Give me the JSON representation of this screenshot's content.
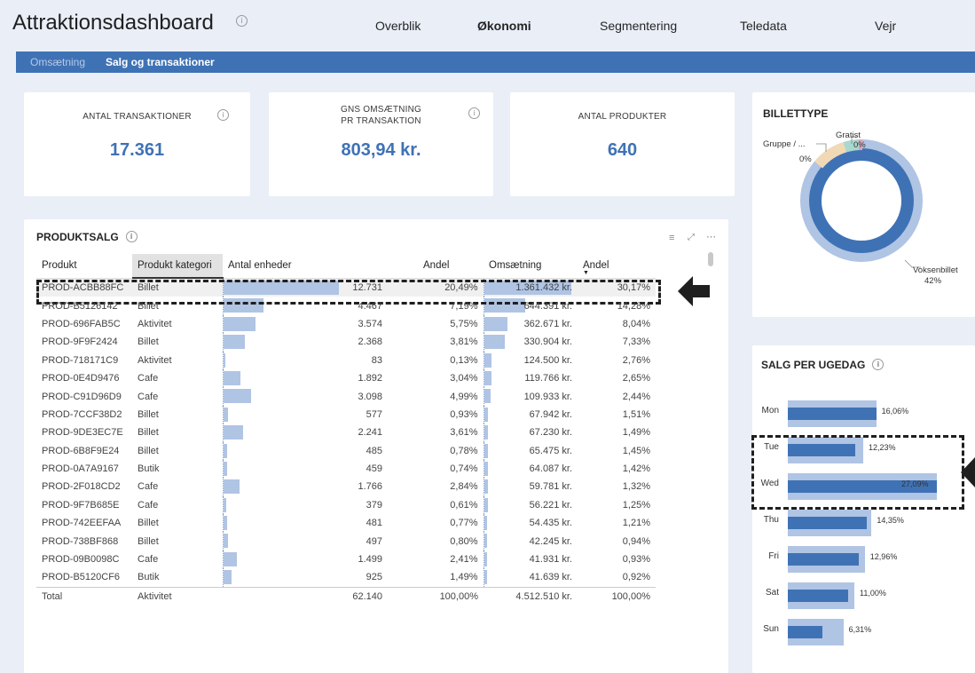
{
  "header": {
    "title": "Attraktionsdashboard",
    "nav": [
      "Overblik",
      "Økonomi",
      "Segmentering",
      "Teledata",
      "Vejr"
    ],
    "active_nav": "Økonomi"
  },
  "subnav": {
    "items": [
      "Omsætning",
      "Salg og transaktioner"
    ],
    "active": "Salg og transaktioner"
  },
  "kpis": [
    {
      "label": "ANTAL TRANSAKTIONER",
      "value": "17.361"
    },
    {
      "label": "GNS OMSÆTNING PR TRANSAKTION",
      "label_line1": "GNS OMSÆTNING",
      "label_line2": "PR TRANSAKTION",
      "value": "803,94 kr."
    },
    {
      "label": "ANTAL PRODUKTER",
      "value": "640"
    }
  ],
  "produktsalg": {
    "title": "PRODUKTSALG",
    "columns": [
      "Produkt",
      "Produkt kategori",
      "Antal enheder",
      "Andel",
      "Omsætning",
      "Andel"
    ],
    "rows": [
      {
        "produkt": "PROD-ACBB88FC",
        "kategori": "Billet",
        "enheder": "12.731",
        "enheder_frac": 1.0,
        "andel1": "20,49%",
        "omsaetning": "1.361.432 kr.",
        "oms_frac": 1.0,
        "andel2": "30,17%"
      },
      {
        "produkt": "PROD-B5126142",
        "kategori": "Billet",
        "enheder": "4.467",
        "enheder_frac": 0.351,
        "andel1": "7,19%",
        "omsaetning": "644.391 kr.",
        "oms_frac": 0.473,
        "andel2": "14,28%"
      },
      {
        "produkt": "PROD-696FAB5C",
        "kategori": "Aktivitet",
        "enheder": "3.574",
        "enheder_frac": 0.281,
        "andel1": "5,75%",
        "omsaetning": "362.671 kr.",
        "oms_frac": 0.266,
        "andel2": "8,04%"
      },
      {
        "produkt": "PROD-9F9F2424",
        "kategori": "Billet",
        "enheder": "2.368",
        "enheder_frac": 0.186,
        "andel1": "3,81%",
        "omsaetning": "330.904 kr.",
        "oms_frac": 0.243,
        "andel2": "7,33%"
      },
      {
        "produkt": "PROD-718171C9",
        "kategori": "Aktivitet",
        "enheder": "83",
        "enheder_frac": 0.007,
        "andel1": "0,13%",
        "omsaetning": "124.500 kr.",
        "oms_frac": 0.091,
        "andel2": "2,76%"
      },
      {
        "produkt": "PROD-0E4D9476",
        "kategori": "Cafe",
        "enheder": "1.892",
        "enheder_frac": 0.149,
        "andel1": "3,04%",
        "omsaetning": "119.766 kr.",
        "oms_frac": 0.088,
        "andel2": "2,65%"
      },
      {
        "produkt": "PROD-C91D96D9",
        "kategori": "Cafe",
        "enheder": "3.098",
        "enheder_frac": 0.243,
        "andel1": "4,99%",
        "omsaetning": "109.933 kr.",
        "oms_frac": 0.081,
        "andel2": "2,44%"
      },
      {
        "produkt": "PROD-7CCF38D2",
        "kategori": "Billet",
        "enheder": "577",
        "enheder_frac": 0.045,
        "andel1": "0,93%",
        "omsaetning": "67.942 kr.",
        "oms_frac": 0.05,
        "andel2": "1,51%"
      },
      {
        "produkt": "PROD-9DE3EC7E",
        "kategori": "Billet",
        "enheder": "2.241",
        "enheder_frac": 0.176,
        "andel1": "3,61%",
        "omsaetning": "67.230 kr.",
        "oms_frac": 0.049,
        "andel2": "1,49%"
      },
      {
        "produkt": "PROD-6B8F9E24",
        "kategori": "Billet",
        "enheder": "485",
        "enheder_frac": 0.038,
        "andel1": "0,78%",
        "omsaetning": "65.475 kr.",
        "oms_frac": 0.048,
        "andel2": "1,45%"
      },
      {
        "produkt": "PROD-0A7A9167",
        "kategori": "Butik",
        "enheder": "459",
        "enheder_frac": 0.036,
        "andel1": "0,74%",
        "omsaetning": "64.087 kr.",
        "oms_frac": 0.047,
        "andel2": "1,42%"
      },
      {
        "produkt": "PROD-2F018CD2",
        "kategori": "Cafe",
        "enheder": "1.766",
        "enheder_frac": 0.139,
        "andel1": "2,84%",
        "omsaetning": "59.781 kr.",
        "oms_frac": 0.044,
        "andel2": "1,32%"
      },
      {
        "produkt": "PROD-9F7B685E",
        "kategori": "Cafe",
        "enheder": "379",
        "enheder_frac": 0.03,
        "andel1": "0,61%",
        "omsaetning": "56.221 kr.",
        "oms_frac": 0.041,
        "andel2": "1,25%"
      },
      {
        "produkt": "PROD-742EEFAA",
        "kategori": "Billet",
        "enheder": "481",
        "enheder_frac": 0.038,
        "andel1": "0,77%",
        "omsaetning": "54.435 kr.",
        "oms_frac": 0.04,
        "andel2": "1,21%"
      },
      {
        "produkt": "PROD-738BF868",
        "kategori": "Billet",
        "enheder": "497",
        "enheder_frac": 0.039,
        "andel1": "0,80%",
        "omsaetning": "42.245 kr.",
        "oms_frac": 0.031,
        "andel2": "0,94%"
      },
      {
        "produkt": "PROD-09B0098C",
        "kategori": "Cafe",
        "enheder": "1.499",
        "enheder_frac": 0.118,
        "andel1": "2,41%",
        "omsaetning": "41.931 kr.",
        "oms_frac": 0.031,
        "andel2": "0,93%"
      },
      {
        "produkt": "PROD-B5120CF6",
        "kategori": "Butik",
        "enheder": "925",
        "enheder_frac": 0.073,
        "andel1": "1,49%",
        "omsaetning": "41.639 kr.",
        "oms_frac": 0.031,
        "andel2": "0,92%"
      }
    ],
    "total": {
      "label": "Total",
      "kategori": "Aktivitet",
      "enheder": "62.140",
      "andel1": "100,00%",
      "omsaetning": "4.512.510 kr.",
      "andel2": "100,00%"
    }
  },
  "billettype": {
    "title": "BILLETTYPE",
    "labels": [
      {
        "name": "Voksenbillet",
        "pct": "42%"
      },
      {
        "name": "Gruppe / ...",
        "pct": "0%"
      },
      {
        "name": "Gratist",
        "pct": "0%"
      }
    ]
  },
  "chart_data": {
    "type": "bar",
    "title": "SALG PER UGEDAG",
    "categories": [
      "Mon",
      "Tue",
      "Wed",
      "Thu",
      "Fri",
      "Sat",
      "Sun"
    ],
    "values": [
      16.06,
      12.23,
      27.09,
      14.35,
      12.96,
      11.0,
      6.31
    ],
    "value_labels": [
      "16,06%",
      "12,23%",
      "27,09%",
      "14,35%",
      "12,96%",
      "11,00%",
      "6,31%"
    ],
    "orientation": "horizontal"
  },
  "colors": {
    "accent": "#3f72b5",
    "light_bar": "#b0c4e4",
    "subnav": "#3f72b5"
  }
}
